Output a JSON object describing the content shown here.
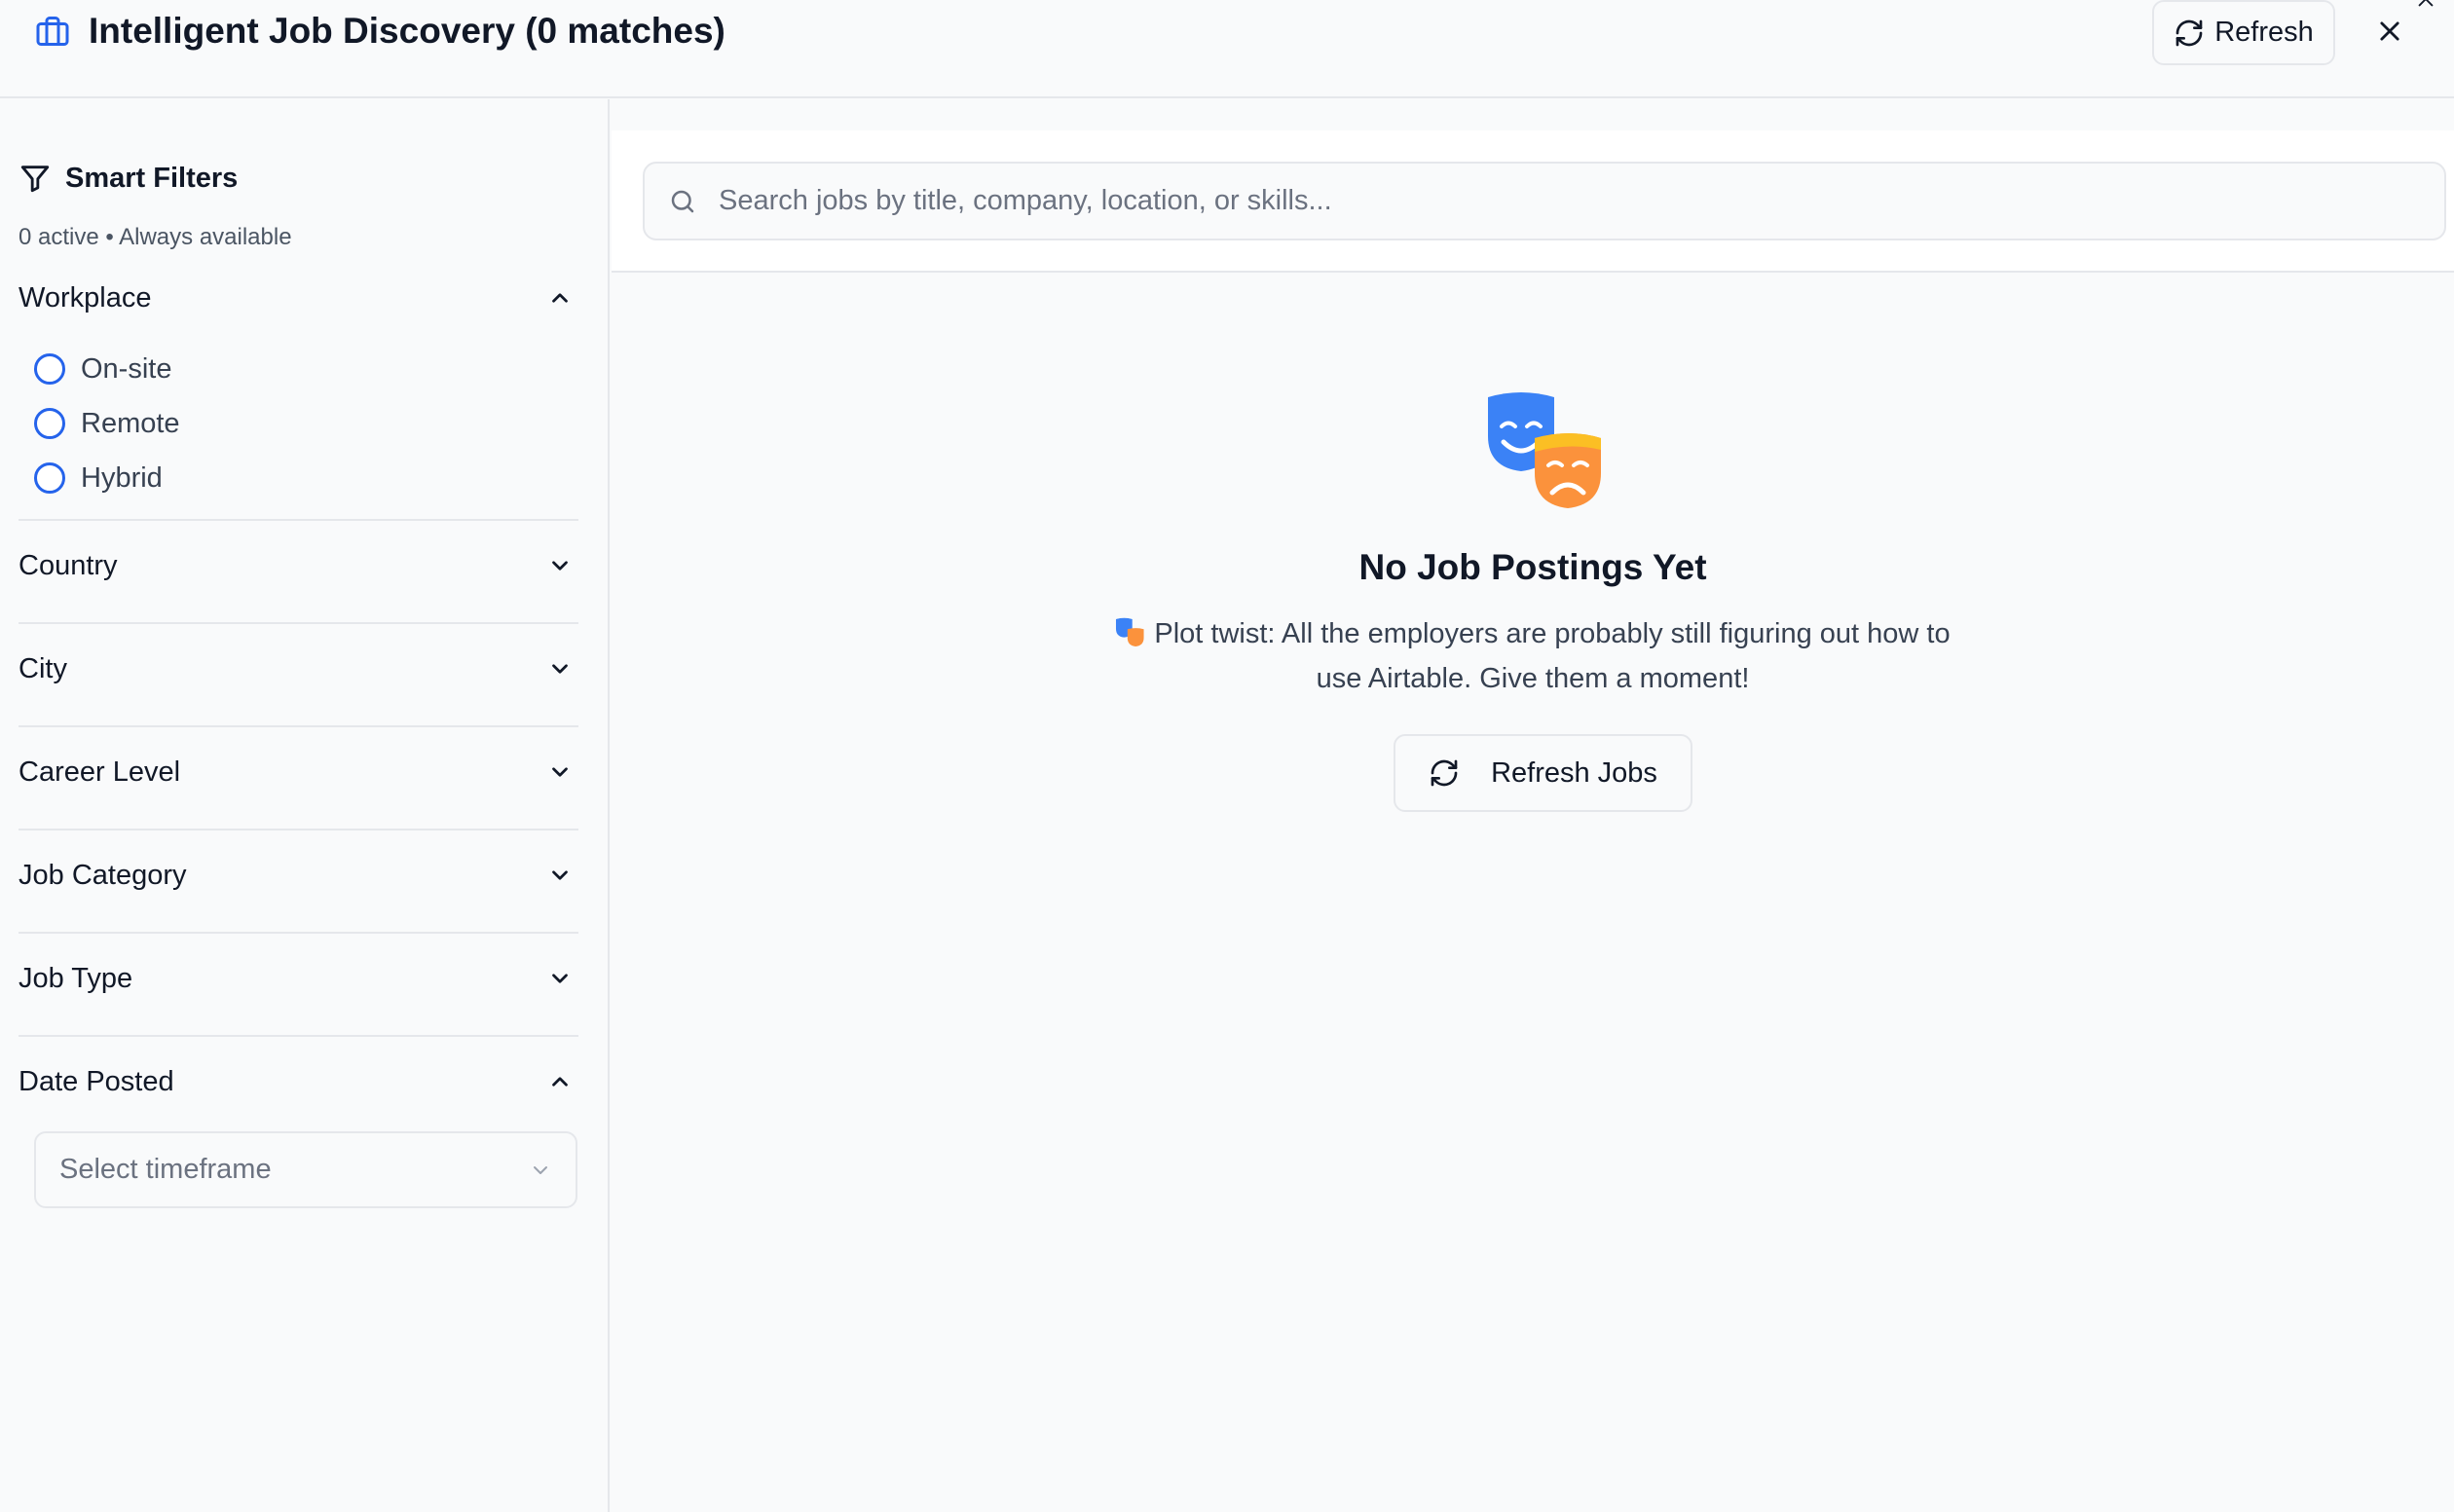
{
  "header": {
    "title": "Intelligent Job Discovery (0 matches)",
    "refresh_label": "Refresh",
    "icon": "briefcase-icon"
  },
  "sidebar": {
    "title": "Smart Filters",
    "subtitle": "0 active • Always available",
    "sections": {
      "workplace": {
        "label": "Workplace",
        "expanded": true,
        "options": [
          "On-site",
          "Remote",
          "Hybrid"
        ]
      },
      "country": {
        "label": "Country",
        "expanded": false
      },
      "city": {
        "label": "City",
        "expanded": false
      },
      "career_level": {
        "label": "Career Level",
        "expanded": false
      },
      "job_category": {
        "label": "Job Category",
        "expanded": false
      },
      "job_type": {
        "label": "Job Type",
        "expanded": false
      },
      "date_posted": {
        "label": "Date Posted",
        "expanded": true,
        "placeholder": "Select timeframe"
      }
    }
  },
  "search": {
    "placeholder": "Search jobs by title, company, location, or skills..."
  },
  "empty_state": {
    "icon": "theater-masks-icon",
    "title": "No Job Postings Yet",
    "message": "Plot twist: All the employers are probably still figuring out how to use Airtable. Give them a moment!",
    "button_label": "Refresh Jobs"
  },
  "colors": {
    "accent": "#2563eb",
    "border": "#e5e7eb",
    "background": "#f9fafb",
    "mask_blue": "#3b82f6",
    "mask_orange": "#f59e0b"
  }
}
